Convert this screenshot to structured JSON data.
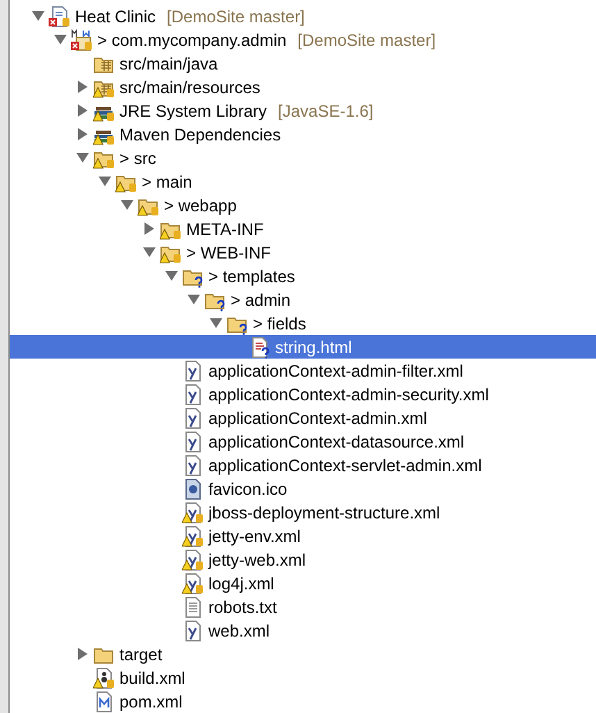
{
  "tree": [
    {
      "label": "Heat Clinic",
      "suffix": "[DemoSite master]",
      "kind": "project",
      "error": true,
      "expanded": true,
      "selected": false,
      "children": [
        {
          "label": "> com.mycompany.admin",
          "suffix": "[DemoSite master]",
          "kind": "maven-project",
          "error": true,
          "expanded": true,
          "selected": false,
          "children": [
            {
              "label": "src/main/java",
              "kind": "source-folder",
              "selected": false
            },
            {
              "label": "src/main/resources",
              "kind": "source-folder",
              "warning": true,
              "expanded": false,
              "selected": false
            },
            {
              "label": "JRE System Library",
              "suffix": "[JavaSE-1.6]",
              "kind": "library",
              "warning": true,
              "expanded": false,
              "selected": false
            },
            {
              "label": "Maven Dependencies",
              "kind": "library",
              "warning": true,
              "expanded": false,
              "selected": false
            },
            {
              "label": "> src",
              "kind": "folder",
              "warning": true,
              "expanded": true,
              "selected": false,
              "children": [
                {
                  "label": "> main",
                  "kind": "folder",
                  "warning": true,
                  "expanded": true,
                  "selected": false,
                  "children": [
                    {
                      "label": "> webapp",
                      "kind": "folder",
                      "warning": true,
                      "expanded": true,
                      "selected": false,
                      "children": [
                        {
                          "label": "META-INF",
                          "kind": "folder",
                          "warning": true,
                          "expanded": false,
                          "selected": false
                        },
                        {
                          "label": "> WEB-INF",
                          "kind": "folder",
                          "warning": true,
                          "expanded": true,
                          "selected": false,
                          "children": [
                            {
                              "label": "> templates",
                              "kind": "folder",
                              "untracked": true,
                              "expanded": true,
                              "selected": false,
                              "children": [
                                {
                                  "label": "> admin",
                                  "kind": "folder",
                                  "untracked": true,
                                  "expanded": true,
                                  "selected": false,
                                  "children": [
                                    {
                                      "label": "> fields",
                                      "kind": "folder",
                                      "untracked": true,
                                      "expanded": true,
                                      "selected": false,
                                      "children": [
                                        {
                                          "label": "string.html",
                                          "kind": "html-file",
                                          "untracked": true,
                                          "selected": true
                                        }
                                      ]
                                    }
                                  ]
                                }
                              ]
                            },
                            {
                              "label": "applicationContext-admin-filter.xml",
                              "kind": "xml-file",
                              "selected": false
                            },
                            {
                              "label": "applicationContext-admin-security.xml",
                              "kind": "xml-file",
                              "selected": false
                            },
                            {
                              "label": "applicationContext-admin.xml",
                              "kind": "xml-file",
                              "selected": false
                            },
                            {
                              "label": "applicationContext-datasource.xml",
                              "kind": "xml-file",
                              "selected": false
                            },
                            {
                              "label": "applicationContext-servlet-admin.xml",
                              "kind": "xml-file",
                              "selected": false
                            },
                            {
                              "label": "favicon.ico",
                              "kind": "image-file",
                              "selected": false
                            },
                            {
                              "label": "jboss-deployment-structure.xml",
                              "kind": "xml-file",
                              "warning": true,
                              "selected": false
                            },
                            {
                              "label": "jetty-env.xml",
                              "kind": "xml-file",
                              "warning": true,
                              "selected": false
                            },
                            {
                              "label": "jetty-web.xml",
                              "kind": "xml-file",
                              "warning": true,
                              "selected": false
                            },
                            {
                              "label": "log4j.xml",
                              "kind": "xml-file",
                              "warning": true,
                              "selected": false
                            },
                            {
                              "label": "robots.txt",
                              "kind": "text-file",
                              "selected": false
                            },
                            {
                              "label": "web.xml",
                              "kind": "xml-file",
                              "selected": false
                            }
                          ]
                        }
                      ]
                    }
                  ]
                }
              ]
            },
            {
              "label": "target",
              "kind": "plain-folder",
              "expanded": false,
              "selected": false
            },
            {
              "label": "build.xml",
              "kind": "ant-file",
              "warning": true,
              "selected": false
            },
            {
              "label": "pom.xml",
              "kind": "pom-file",
              "selected": false
            }
          ]
        }
      ]
    }
  ]
}
